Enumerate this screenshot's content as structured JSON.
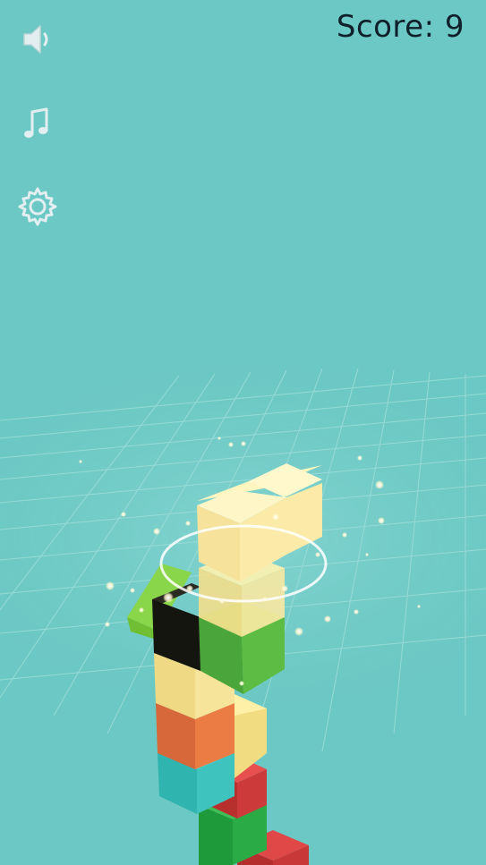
{
  "hud": {
    "score_label": "Score:",
    "score_value": "9"
  },
  "controls": {
    "sound_icon": "speaker-icon",
    "music_icon": "music-note-icon",
    "settings_icon": "gear-icon"
  },
  "colors": {
    "background": "#6cc8c4",
    "grid_line": "#a6e0dc",
    "icon": "#e2eef0",
    "score_text": "#0f1f2b"
  },
  "blocks": [
    {
      "color": "yellow"
    },
    {
      "color": "yellow"
    },
    {
      "color": "green"
    },
    {
      "color": "black"
    },
    {
      "color": "lime"
    },
    {
      "color": "yellow"
    },
    {
      "color": "orange"
    },
    {
      "color": "teal"
    },
    {
      "color": "red"
    },
    {
      "color": "green"
    },
    {
      "color": "red"
    }
  ]
}
